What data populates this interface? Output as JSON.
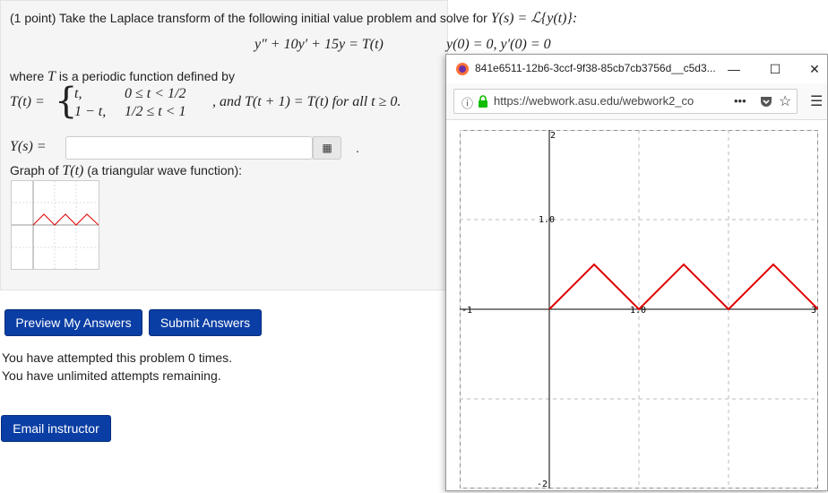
{
  "problem": {
    "intro": "(1 point) Take the Laplace transform of the following initial value problem and solve for",
    "ys_eq": "Y(s) = ℒ{y(t)}:",
    "ode": "y″ + 10y′ + 15y = T(t)",
    "ic": "y(0) = 0,  y′(0) = 0",
    "where_text": "where",
    "where_T": "T",
    "where_rest": "is a periodic function defined by",
    "T_lhs": "T(t) =",
    "case1_expr": "t,",
    "case1_cond": "0 ≤ t < 1/2",
    "case2_expr": "1 − t,",
    "case2_cond": "1/2 ≤ t < 1",
    "periodic": ", and T(t + 1) = T(t) for all t ≥ 0.",
    "ys_label": "Y(s) =",
    "answer_value": "",
    "period_after": ".",
    "graph_caption_pre": "Graph of",
    "graph_caption_T": "T(t)",
    "graph_caption_post": "(a triangular wave function):"
  },
  "buttons": {
    "preview": "Preview My Answers",
    "submit": "Submit Answers",
    "email": "Email instructor"
  },
  "status": {
    "attempts": "You have attempted this problem 0 times.",
    "remaining": "You have unlimited attempts remaining."
  },
  "popup": {
    "title": "841e6511-12b6-3ccf-9f38-85cb7cb3756d__c5d3...",
    "url": "https://webwork.asu.edu/webwork2_co",
    "menu_dots": "•••"
  },
  "colors": {
    "button_bg": "#0a3ea4",
    "curve": "#e00000",
    "problem_bg": "#f5f5f5"
  },
  "chart_data": {
    "type": "line",
    "title": "",
    "xlabel": "",
    "ylabel": "",
    "xlim": [
      -1,
      3
    ],
    "ylim": [
      -2,
      2
    ],
    "tick_labels": {
      "x_left": "-1",
      "x_mid": "1.0",
      "x_right": "3",
      "y_top": "2",
      "y_mid": "1.0",
      "y_bottom": "-2"
    },
    "series": [
      {
        "x": [
          0,
          0.5,
          1,
          1.5,
          2,
          2.5,
          3
        ],
        "y": [
          0,
          0.5,
          0,
          0.5,
          0,
          0.5,
          0
        ]
      }
    ]
  }
}
